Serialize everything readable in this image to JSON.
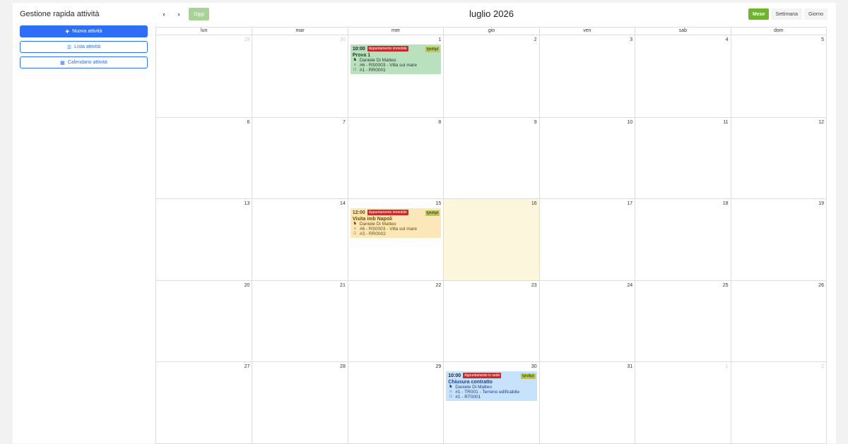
{
  "sidebar": {
    "title": "Gestione rapida attività",
    "new_btn": "Nuova attività",
    "list_btn": "Lista attività",
    "calendar_btn": "Calendario attività",
    "icons": {
      "new": "plus-icon",
      "list": "list-icon",
      "calendar": "calendar-icon"
    }
  },
  "toolbar": {
    "prev": "‹",
    "next": "›",
    "today": "Oggi",
    "title": "luglio 2026",
    "views": [
      "Mese",
      "Settimana",
      "Giorno"
    ],
    "active_view": "Mese"
  },
  "weekdays": [
    "lun",
    "mar",
    "mer",
    "gio",
    "ven",
    "sab",
    "dom"
  ],
  "weeks": [
    [
      {
        "num": "29",
        "other": true
      },
      {
        "num": "30",
        "other": true
      },
      {
        "num": "1",
        "event": 0
      },
      {
        "num": "2"
      },
      {
        "num": "3"
      },
      {
        "num": "4"
      },
      {
        "num": "5"
      }
    ],
    [
      {
        "num": "6"
      },
      {
        "num": "7"
      },
      {
        "num": "8"
      },
      {
        "num": "9"
      },
      {
        "num": "10"
      },
      {
        "num": "11"
      },
      {
        "num": "12"
      }
    ],
    [
      {
        "num": "13"
      },
      {
        "num": "14"
      },
      {
        "num": "15",
        "event": 1
      },
      {
        "num": "16",
        "today": true
      },
      {
        "num": "17"
      },
      {
        "num": "18"
      },
      {
        "num": "19"
      }
    ],
    [
      {
        "num": "20"
      },
      {
        "num": "21"
      },
      {
        "num": "22"
      },
      {
        "num": "23"
      },
      {
        "num": "24"
      },
      {
        "num": "25"
      },
      {
        "num": "26"
      }
    ],
    [
      {
        "num": "27"
      },
      {
        "num": "28"
      },
      {
        "num": "29"
      },
      {
        "num": "30",
        "event": 2
      },
      {
        "num": "31"
      },
      {
        "num": "1",
        "other": true
      },
      {
        "num": "2",
        "other": true
      }
    ]
  ],
  "events": [
    {
      "color": "green",
      "time": "10:00",
      "type": "Appuntamento immobile",
      "tag": "fghdfgd",
      "title": "Prova 1",
      "person": "Daniele Di Matteo",
      "property": "#6 - RS0003 - Villa sul mare",
      "doc": "#1 - RR0001"
    },
    {
      "color": "yellow",
      "time": "12:00",
      "type": "Appuntamento immobile",
      "tag": "fghdfgd",
      "title": "Visita imb Napoli",
      "person": "Daniele Di Matteo",
      "property": "#6 - RS0003 - Villa sul mare",
      "doc": "#3 - RR0002"
    },
    {
      "color": "blue",
      "time": "10:00",
      "type": "Appuntamento in sede",
      "tag": "fghdfgd",
      "title": "Chiusura contratto",
      "person": "Daniele Di Matteo",
      "property": "#1 - TR001 - Terreno edificabile",
      "doc": "#1 - RT0001"
    }
  ],
  "colors": {
    "primary": "#2e6df5",
    "active_view": "#6fb32e",
    "today_btn": "#a7d494",
    "today_cell": "#fcf7dc"
  }
}
